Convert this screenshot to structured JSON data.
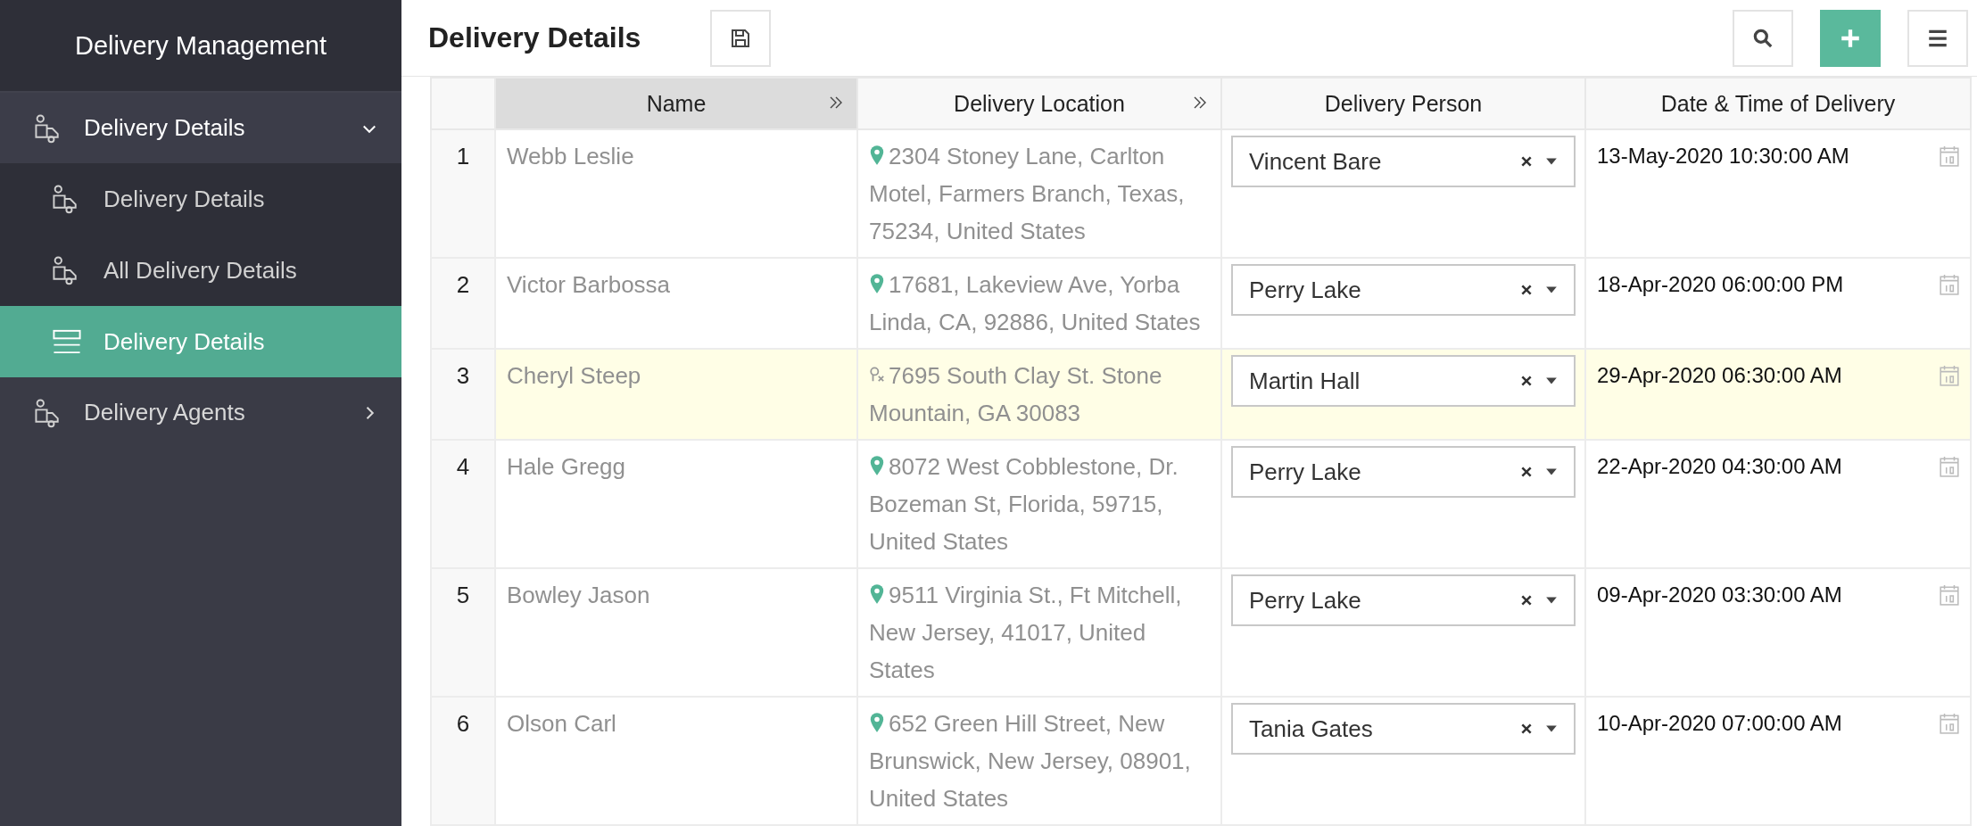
{
  "sidebar": {
    "title": "Delivery Management",
    "items": [
      {
        "label": "Delivery Details",
        "kind": "truck",
        "expanded": true,
        "children": [
          {
            "label": "Delivery Details",
            "kind": "truck",
            "selected": false
          },
          {
            "label": "All Delivery Details",
            "kind": "truck",
            "selected": false
          },
          {
            "label": "Delivery Details",
            "kind": "list",
            "selected": true
          }
        ]
      },
      {
        "label": "Delivery Agents",
        "kind": "truck",
        "expanded": false
      }
    ]
  },
  "header": {
    "title": "Delivery Details"
  },
  "table": {
    "columns": [
      {
        "label": "Name",
        "selected": true,
        "expandable": true
      },
      {
        "label": "Delivery Location",
        "selected": false,
        "expandable": true
      },
      {
        "label": "Delivery Person",
        "selected": false,
        "expandable": false
      },
      {
        "label": "Date & Time of Delivery",
        "selected": false,
        "expandable": false
      }
    ],
    "rows": [
      {
        "number": "1",
        "name": "Webb Leslie",
        "location": "2304 Stoney Lane, Carlton Motel, Farmers Branch, Texas, 75234, United States",
        "kind": "pin",
        "person": "Vincent Bare",
        "datetime": "13-May-2020 10:30:00 AM",
        "selected": false
      },
      {
        "number": "2",
        "name": "Victor Barbossa",
        "location": "17681, Lakeview Ave, Yorba Linda, CA, 92886, United States",
        "kind": "pin",
        "person": "Perry Lake",
        "datetime": "18-Apr-2020 06:00:00 PM",
        "selected": false
      },
      {
        "number": "3",
        "name": "Cheryl Steep",
        "location": "7695 South Clay St. Stone Mountain, GA 30083",
        "kind": "unmapped",
        "person": "Martin Hall",
        "datetime": "29-Apr-2020 06:30:00 AM",
        "selected": true
      },
      {
        "number": "4",
        "name": "Hale Gregg",
        "location": "8072 West Cobblestone, Dr. Bozeman St, Florida, 59715, United States",
        "kind": "pin",
        "person": "Perry Lake",
        "datetime": "22-Apr-2020 04:30:00 AM",
        "selected": false
      },
      {
        "number": "5",
        "name": "Bowley Jason",
        "location": "9511 Virginia St., Ft Mitchell, New Jersey, 41017, United States",
        "kind": "pin",
        "person": "Perry Lake",
        "datetime": "09-Apr-2020 03:30:00 AM",
        "selected": false
      },
      {
        "number": "6",
        "name": "Olson Carl",
        "location": "652 Green Hill Street, New Brunswick, New Jersey, 08901, United States",
        "kind": "pin",
        "person": "Tania Gates",
        "datetime": "10-Apr-2020 07:00:00 AM",
        "selected": false
      }
    ]
  }
}
